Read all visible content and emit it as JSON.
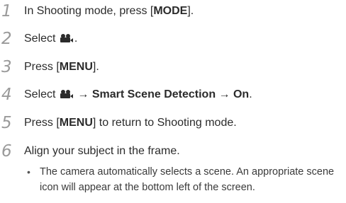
{
  "steps": [
    {
      "num": "1",
      "before": "In Shooting mode, press [",
      "bold": "MODE",
      "after": "]."
    },
    {
      "num": "2",
      "before": "Select ",
      "icon": "movie-camera-icon",
      "after": "."
    },
    {
      "num": "3",
      "before": "Press [",
      "bold": "MENU",
      "after": "]."
    },
    {
      "num": "4",
      "before": "Select ",
      "icon": "movie-camera-icon",
      "arrow1": " → ",
      "bold1": "Smart Scene Detection",
      "arrow2": " → ",
      "bold2": "On",
      "after": "."
    },
    {
      "num": "5",
      "before": "Press [",
      "bold": "MENU",
      "after": "] to return to Shooting mode."
    },
    {
      "num": "6",
      "text": "Align your subject in the frame."
    }
  ],
  "bullet": {
    "mark": "•",
    "text": "The camera automatically selects a scene. An appropriate scene icon will appear at the bottom left of the screen."
  }
}
